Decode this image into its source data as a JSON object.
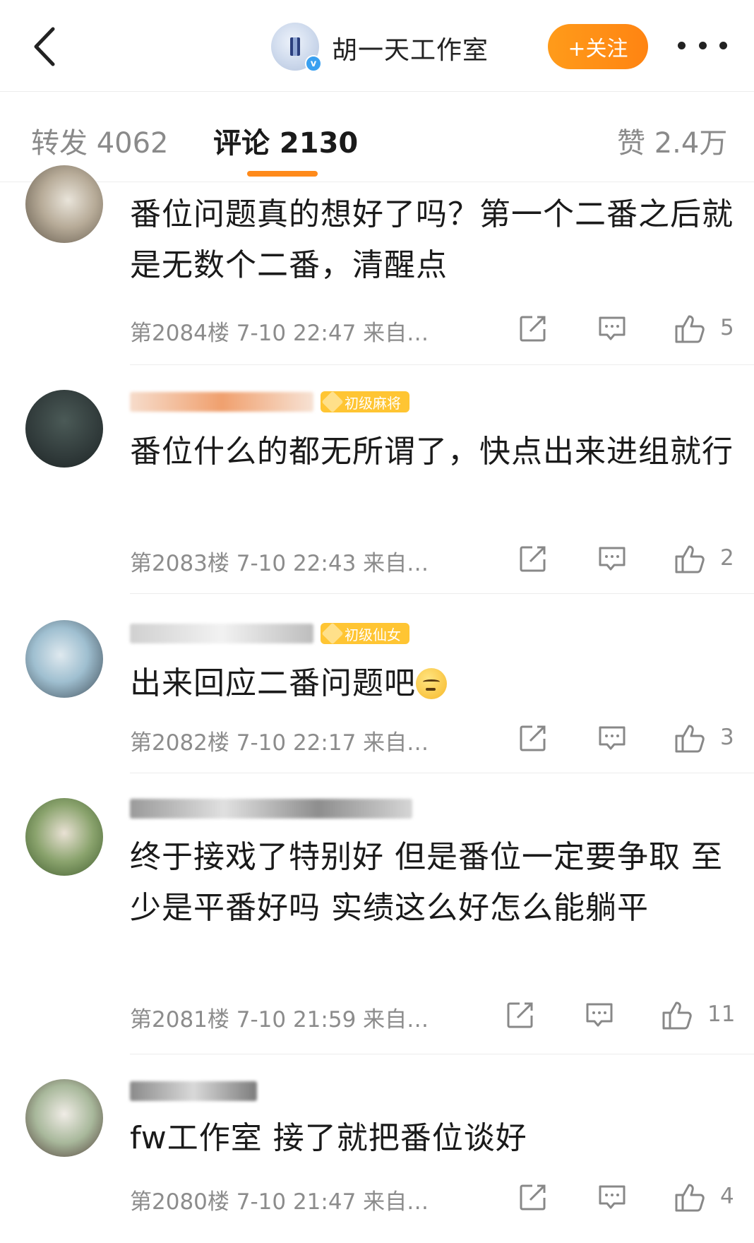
{
  "header": {
    "title": "胡一天工作室",
    "follow_label": "+关注",
    "verified_mark": "v"
  },
  "tabs": [
    {
      "label": "转发 4062"
    },
    {
      "label": "评论 2130"
    },
    {
      "label": "赞 2.4万"
    }
  ],
  "comments": [
    {
      "text": "番位问题真的想好了吗？第一个二番之后就是无数个二番，清醒点",
      "meta": "第2084楼 7-10 22:47 来自…",
      "likes": "5"
    },
    {
      "badge": "初级麻将",
      "text": "番位什么的都无所谓了，快点出来进组就行",
      "meta": "第2083楼 7-10 22:43 来自…",
      "likes": "2"
    },
    {
      "badge": "初级仙女",
      "text": "出来回应二番问题吧",
      "meta": "第2082楼 7-10 22:17 来自…",
      "likes": "3"
    },
    {
      "text": "终于接戏了特别好 但是番位一定要争取 至少是平番好吗 实绩这么好怎么能躺平",
      "meta": "第2081楼 7-10 21:59 来自…",
      "likes": "11"
    },
    {
      "text": "fw工作室 接了就把番位谈好",
      "meta": "第2080楼 7-10 21:47 来自…",
      "likes": "4"
    }
  ],
  "colors": {
    "accent": "#ff8a1a",
    "badge": "#ffc533",
    "meta_text": "#8c8c8c"
  },
  "icons": [
    "back-arrow-icon",
    "verified-icon",
    "more-icon",
    "repost-icon",
    "comment-icon",
    "like-icon",
    "emoji-face-icon"
  ]
}
